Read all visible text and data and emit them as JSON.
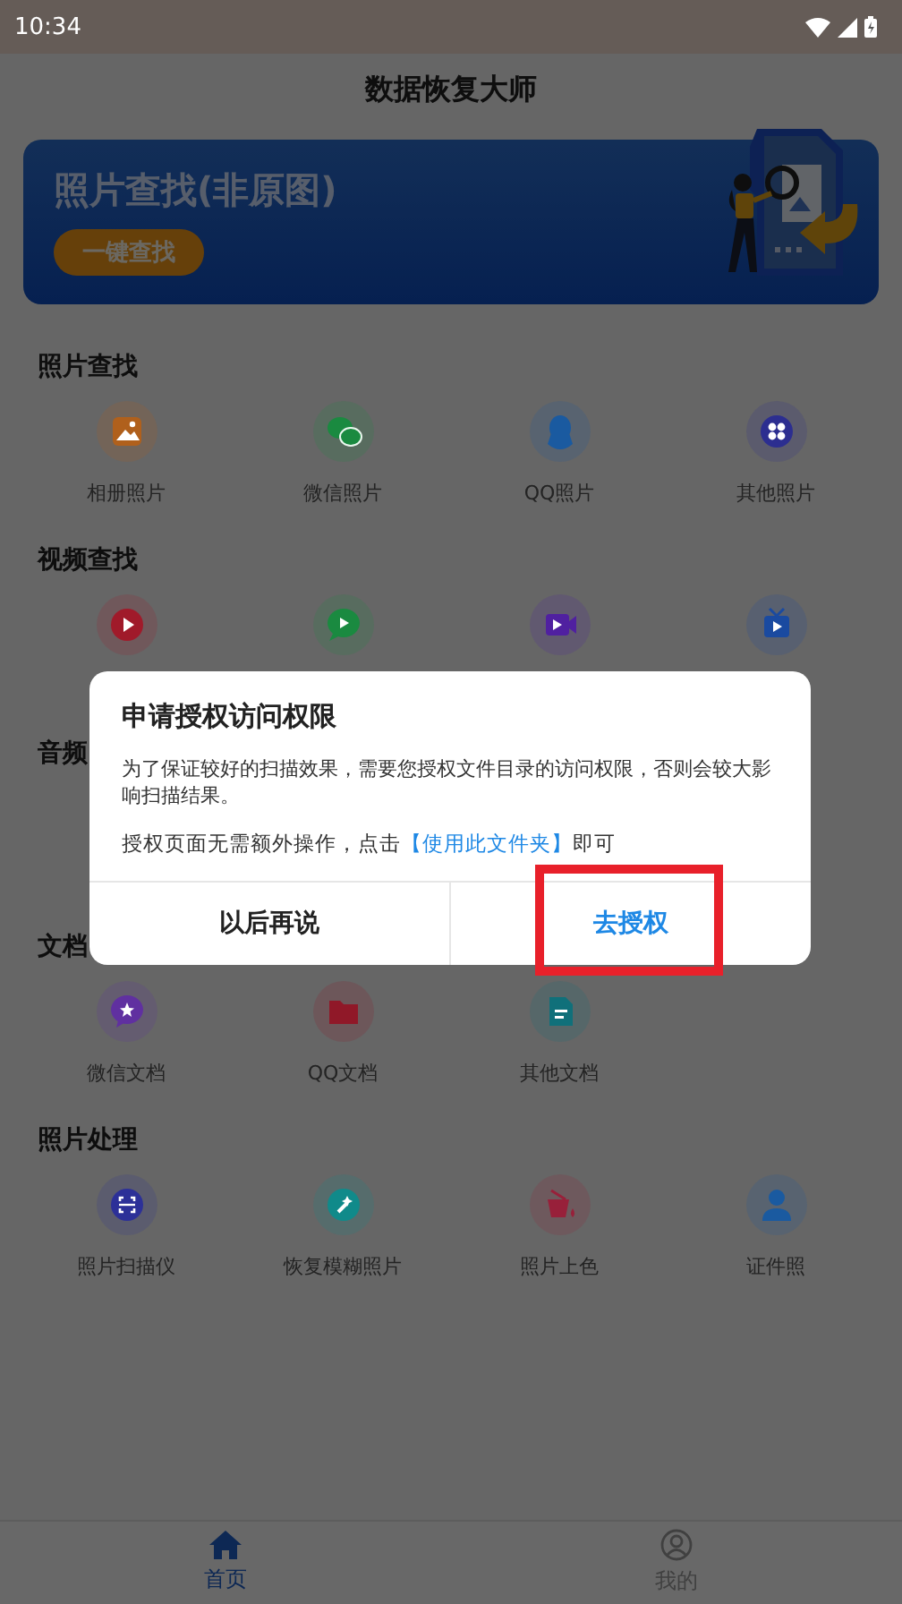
{
  "status_bar": {
    "time": "10:34"
  },
  "app_bar": {
    "title": "数据恢复大师"
  },
  "banner": {
    "title": "照片查找(非原图)",
    "button": "一键查找"
  },
  "sections": [
    {
      "title": "照片查找",
      "items": [
        {
          "label": "相册照片",
          "color": "#b0601c"
        },
        {
          "label": "微信照片",
          "color": "#1a8a40"
        },
        {
          "label": "QQ照片",
          "color": "#1a5aa0"
        },
        {
          "label": "其他照片",
          "color": "#2c2e90"
        }
      ]
    },
    {
      "title": "视频查找",
      "items": [
        {
          "color": "#a01a2a"
        },
        {
          "color": "#1a8a40"
        },
        {
          "color": "#5020a0"
        },
        {
          "color": "#1a4aa0"
        }
      ]
    },
    {
      "title": "音频"
    },
    {
      "title": "文档",
      "items": [
        {
          "label": "微信文档",
          "color": "#6030a0"
        },
        {
          "label": "QQ文档",
          "color": "#901828"
        },
        {
          "label": "其他文档",
          "color": "#10707a"
        }
      ]
    },
    {
      "title": "照片处理",
      "items": [
        {
          "label": "照片扫描仪",
          "color": "#2c3098"
        },
        {
          "label": "恢复模糊照片",
          "color": "#108a8a"
        },
        {
          "label": "照片上色",
          "color": "#98203a"
        },
        {
          "label": "证件照",
          "color": "#1a5aa0"
        }
      ]
    }
  ],
  "bottom_nav": [
    {
      "label": "首页",
      "selected": true
    },
    {
      "label": "我的",
      "selected": false
    }
  ],
  "dialog": {
    "title": "申请授权访问权限",
    "message": "为了保证较好的扫描效果，需要您授权文件目录的访问权限，否则会较大影响扫描结果。",
    "hint": "授权页面无需额外操作，点击",
    "hint_link": "【使用此文件夹】",
    "hint_end": "即可",
    "buttons": [
      {
        "label": "以后再说",
        "kind": "cancel",
        "highlighted": false
      },
      {
        "label": "去授权",
        "kind": "confirm",
        "highlighted": true
      }
    ]
  }
}
